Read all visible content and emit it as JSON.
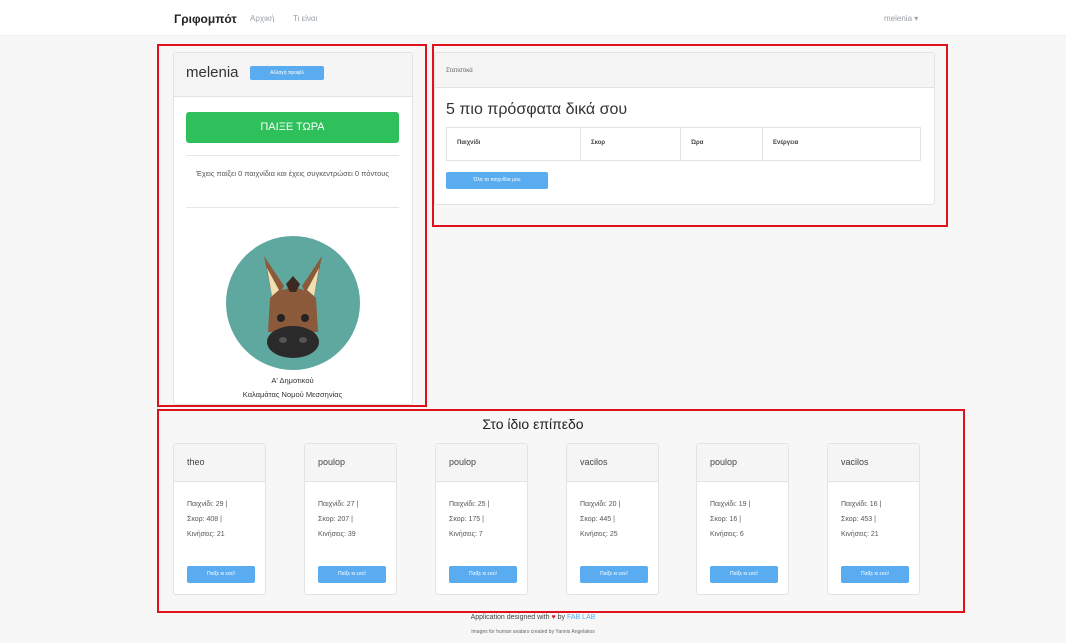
{
  "navbar": {
    "brand": "Γριφομπότ",
    "links": [
      "Αρχική",
      "Τι είναι"
    ],
    "user": "melenia ▾"
  },
  "profile": {
    "username": "melenia",
    "change_label": "Αλλαγή προφίλ",
    "play_label": "ΠΑΙΞΕ ΤΩΡΑ",
    "played_text": "Έχεις παίξει 0 παιχνίδια και έχεις συγκεντρώσει 0 πόντους",
    "avatar_icon": "donkey-avatar-icon",
    "grade_line1": "Α' Δημοτικού",
    "grade_line2": "Καλαμάτας Νομού Μεσσηνίας"
  },
  "stats": {
    "header": "Στατιστικά",
    "title": "5 πιο πρόσφατα δικά σου",
    "columns": [
      "Παιχνίδι",
      "Σκορ",
      "Ώρα",
      "Ενέργεια"
    ],
    "my_games_label": "Όλα τα παιχνίδια μου"
  },
  "level": {
    "title": "Στο ίδιο επίπεδο",
    "players": [
      {
        "name": "theo",
        "games": "Παιχνίδι: 29 |",
        "score": "Σκορ: 408 |",
        "moves": "Κινήσεις: 21",
        "button": "Παίξε κι εσύ!"
      },
      {
        "name": "poulop",
        "games": "Παιχνίδι: 27 |",
        "score": "Σκορ: 207 |",
        "moves": "Κινήσεις: 39",
        "button": "Παίξε κι εσύ!"
      },
      {
        "name": "poulop",
        "games": "Παιχνίδι: 25 |",
        "score": "Σκορ: 175 |",
        "moves": "Κινήσεις: 7",
        "button": "Παίξε κι εσύ!"
      },
      {
        "name": "vacilos",
        "games": "Παιχνίδι: 20 |",
        "score": "Σκορ: 445 |",
        "moves": "Κινήσεις: 25",
        "button": "Παίξε κι εσύ!"
      },
      {
        "name": "poulop",
        "games": "Παιχνίδι: 19 |",
        "score": "Σκορ: 16 |",
        "moves": "Κινήσεις: 6",
        "button": "Παίξε κι εσύ!"
      },
      {
        "name": "vacilos",
        "games": "Παιχνίδι: 16 |",
        "score": "Σκορ: 453 |",
        "moves": "Κινήσεις: 21",
        "button": "Παίξε κι εσύ!"
      }
    ]
  },
  "footer": {
    "designed_prefix": "Application designed with",
    "designed_by": "by",
    "lab": "FAB LAB",
    "credits": "Images for human avatars created by Yannis Angelakos"
  },
  "colors": {
    "highlight_box": "#e0121b",
    "primary_button": "#5aacf0",
    "play_button": "#2ec05b"
  }
}
